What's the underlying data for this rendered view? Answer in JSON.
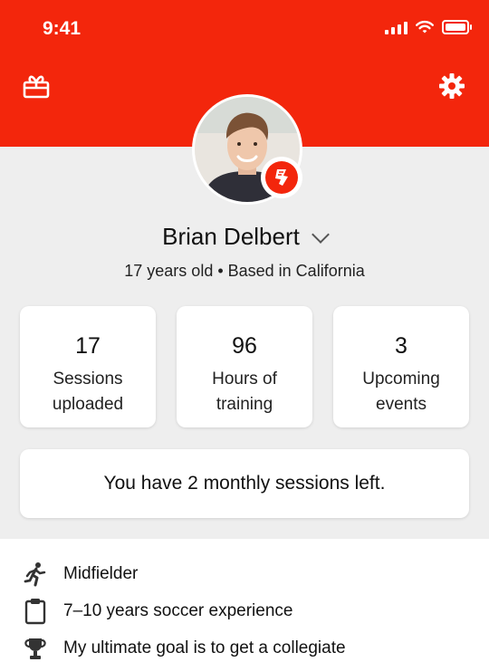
{
  "status_bar": {
    "time": "9:41"
  },
  "header": {
    "left_icon": "gift-icon",
    "right_icon": "gear-icon",
    "accent_color": "#f3260c"
  },
  "profile": {
    "name": "Brian Delbert",
    "subline": "17 years old • Based in California",
    "badge_icon": "boot-badge-icon"
  },
  "stats": [
    {
      "value": "17",
      "label_line1": "Sessions",
      "label_line2": "uploaded"
    },
    {
      "value": "96",
      "label_line1": "Hours of",
      "label_line2": "training"
    },
    {
      "value": "3",
      "label_line1": "Upcoming",
      "label_line2": "events"
    }
  ],
  "notice": {
    "text": "You have 2 monthly sessions left."
  },
  "details": [
    {
      "icon": "runner-icon",
      "text": "Midfielder"
    },
    {
      "icon": "clipboard-icon",
      "text": "7–10 years soccer experience"
    },
    {
      "icon": "trophy-icon",
      "text": "My ultimate goal is to get a collegiate"
    }
  ]
}
